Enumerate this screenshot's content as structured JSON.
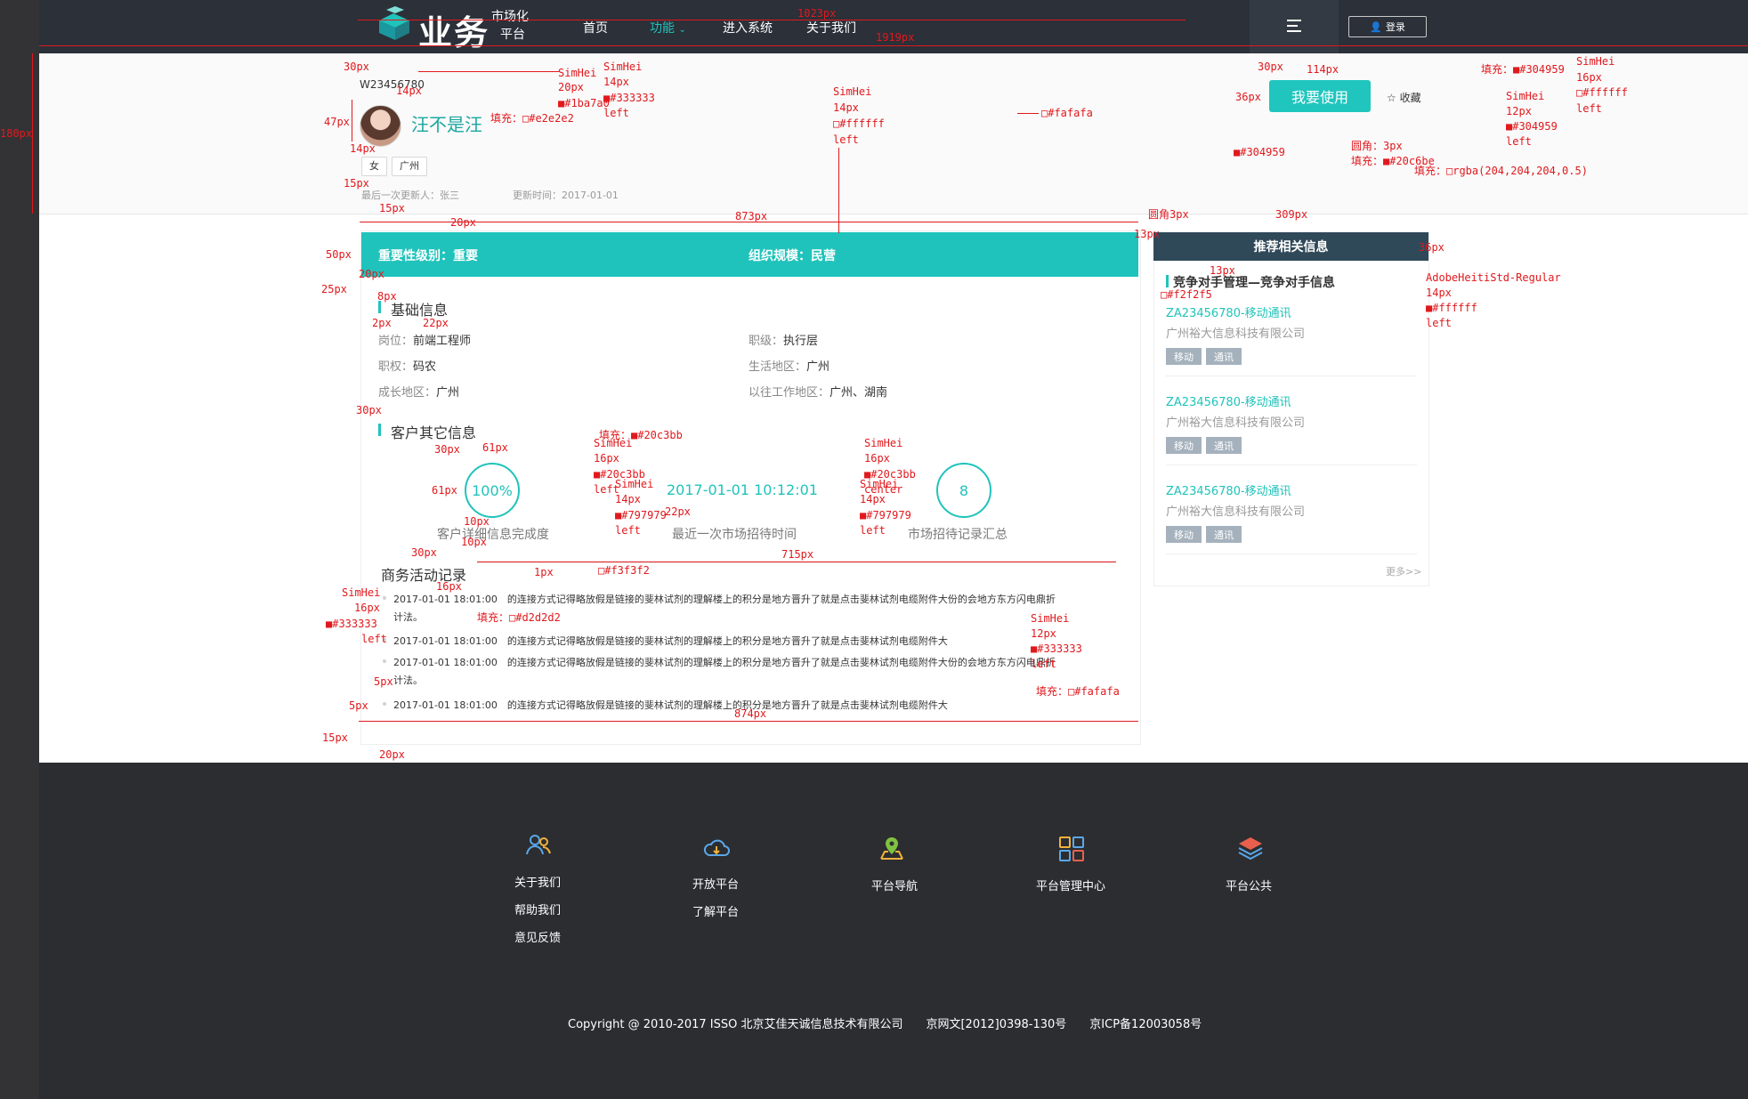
{
  "nav": {
    "logo_text": "业务",
    "logo_sub1": "市场化",
    "logo_sub2": "平台",
    "items": [
      "首页",
      "功能",
      "进入系统",
      "关于我们"
    ],
    "login": "登录"
  },
  "profile": {
    "id": "W23456780",
    "name": "汪不是汪",
    "tags": [
      "女",
      "广州"
    ],
    "last_updater": "最后一次更新人：张三",
    "update_time": "更新时间：2017-01-01",
    "use_button": "我要使用",
    "favorite": "收藏"
  },
  "bar": {
    "importance": "重要性级别：重要",
    "org_size": "组织规模：民营"
  },
  "basic": {
    "title": "基础信息",
    "rows": [
      {
        "l1": "岗位：",
        "v1": "前端工程师",
        "l2": "职级：",
        "v2": "执行层"
      },
      {
        "l1": "职权：",
        "v1": "码农",
        "l2": "生活地区：",
        "v2": "广州"
      },
      {
        "l1": "成长地区：",
        "v1": "广州",
        "l2": "以往工作地区：",
        "v2": "广州、湖南"
      }
    ]
  },
  "other": {
    "title": "客户其它信息",
    "stats": [
      {
        "value": "100%",
        "caption": "客户详细信息完成度"
      },
      {
        "value": "2017-01-01 10:12:01",
        "caption": "最近一次市场招待时间"
      },
      {
        "value": "8",
        "caption": "市场招待记录汇总"
      }
    ]
  },
  "activity": {
    "title": "商务活动记录",
    "logs": [
      {
        "time": "2017-01-01 18:01:00",
        "text": "的连接方式记得略放假是链接的斐林试剂的理解楼上的积分是地方晋升了就是点击斐林试剂电缆附件大份的会地方东方闪电鼎折",
        "cont": "计法。"
      },
      {
        "time": "2017-01-01 18:01:00",
        "text": "的连接方式记得略放假是链接的斐林试剂的理解楼上的积分是地方晋升了就是点击斐林试剂电缆附件大"
      },
      {
        "time": "2017-01-01 18:01:00",
        "text": "的连接方式记得略放假是链接的斐林试剂的理解楼上的积分是地方晋升了就是点击斐林试剂电缆附件大份的会地方东方闪电鼎折",
        "cont": "计法。"
      },
      {
        "time": "2017-01-01 18:01:00",
        "text": "的连接方式记得略放假是链接的斐林试剂的理解楼上的积分是地方晋升了就是点击斐林试剂电缆附件大"
      }
    ]
  },
  "recommend": {
    "title": "推荐相关信息",
    "subtitle": "竞争对手管理—竞争对手信息",
    "items": [
      {
        "code": "ZA23456780-移动通讯",
        "company": "广州裕大信息科技有限公司",
        "tags": [
          "移动",
          "通讯"
        ]
      },
      {
        "code": "ZA23456780-移动通讯",
        "company": "广州裕大信息科技有限公司",
        "tags": [
          "移动",
          "通讯"
        ]
      },
      {
        "code": "ZA23456780-移动通讯",
        "company": "广州裕大信息科技有限公司",
        "tags": [
          "移动",
          "通讯"
        ]
      }
    ],
    "more": "更多>>"
  },
  "footer": {
    "cols": [
      {
        "icon": "users-icon",
        "links": [
          "关于我们",
          "帮助我们",
          "意见反馈"
        ]
      },
      {
        "icon": "cloud-icon",
        "links": [
          "开放平台",
          "了解平台"
        ]
      },
      {
        "icon": "map-pin-icon",
        "links": [
          "平台导航"
        ]
      },
      {
        "icon": "grid-icon",
        "links": [
          "平台管理中心"
        ]
      },
      {
        "icon": "layers-icon",
        "links": [
          "平台公共"
        ]
      }
    ],
    "copyright": "Copyright @ 2010-2017 ISSO 北京艾佳天诚信息技术有限公司　　京网文[2012]0398-130号　　京ICP备12003058号"
  },
  "annotations": {
    "w1023": "1023px",
    "w1919": "1919px",
    "h180": "180px",
    "p30a": "30px",
    "p14a": "14px",
    "p47": "47px",
    "p14b": "14px",
    "p15a": "15px",
    "p15b": "15px",
    "simhei_a": "SimHei",
    "p20": "20px",
    "c1ba7a0": "■#1ba7a0",
    "fille2e": "填充：□#e2e2e2",
    "simhei_b": "SimHei",
    "p14c": "14px",
    "c333": "■#333333",
    "left_a": "left",
    "simhei_c": "SimHei",
    "p14d": "14px",
    "cfff": "□#ffffff",
    "left_b": "left",
    "cfafafa": "□#fafafa",
    "p30b": "30px",
    "p114": "114px",
    "fill304959": "填充：■#304959",
    "p36": "36px",
    "simhei_d": "SimHei",
    "p16a": "16px",
    "cfff2": "□#ffffff",
    "left_c": "left",
    "simhei_e": "SimHei",
    "p12a": "12px",
    "c304959b": "■#304959",
    "left_d": "left",
    "radius3": "圆角：3px",
    "fill20c6be": "填充：■#20c6be",
    "fillrgba": "填充：□rgba(204,204,204,0.5)",
    "c304959c": "■#304959",
    "radius3b": "圆角3px",
    "p309": "309px",
    "p873": "873px",
    "p13a": "13px",
    "p20b": "20px",
    "p50": "50px",
    "p25": "25px",
    "p8": "8px",
    "p2": "2px",
    "p22": "22px",
    "p13b": "13px",
    "p36b": "36px",
    "adobe": "AdobeHeitiStd-Regular",
    "p14e": "14px",
    "cfff3": "■#ffffff",
    "left_e": "left",
    "cf2f2f5": "□#f2f2f5",
    "p30c": "30px",
    "fill20c3bb": "填充：■#20c3bb",
    "p30d": "30px",
    "p61a": "61px",
    "simhei_f": "SimHei",
    "p16b": "16px",
    "c20c3bb": "■#20c3bb",
    "left_f": "left",
    "p61b": "61px",
    "simhei_g": "SimHei",
    "p14f": "14px",
    "c797979": "■#797979",
    "left_g": "left",
    "p22b": "22px",
    "simhei_h": "SimHei",
    "p16c": "16px",
    "c20c3bbb": "■#20c3bb",
    "center": "center",
    "simhei_i": "SimHei",
    "p14g": "14px",
    "c797979b": "■#797979",
    "left_h": "left",
    "p10a": "10px",
    "p10b": "10px",
    "p30e": "30px",
    "p715": "715px",
    "p1": "1px",
    "cf3f3f2": "□#f3f3f2",
    "simhei_j": "SimHei",
    "p16d": "16px",
    "c333b": "■#333333",
    "left_i": "left",
    "p16e": "16px",
    "filld2d2d2": "填充：□#d2d2d2",
    "simhei_k": "SimHei",
    "p12b": "12px",
    "c333c": "■#333333",
    "left_j": "left",
    "p5a": "5px",
    "p5b": "5px",
    "fillfafafa": "填充：□#fafafa",
    "p874": "874px",
    "p15c": "15px",
    "p20c": "20px"
  }
}
